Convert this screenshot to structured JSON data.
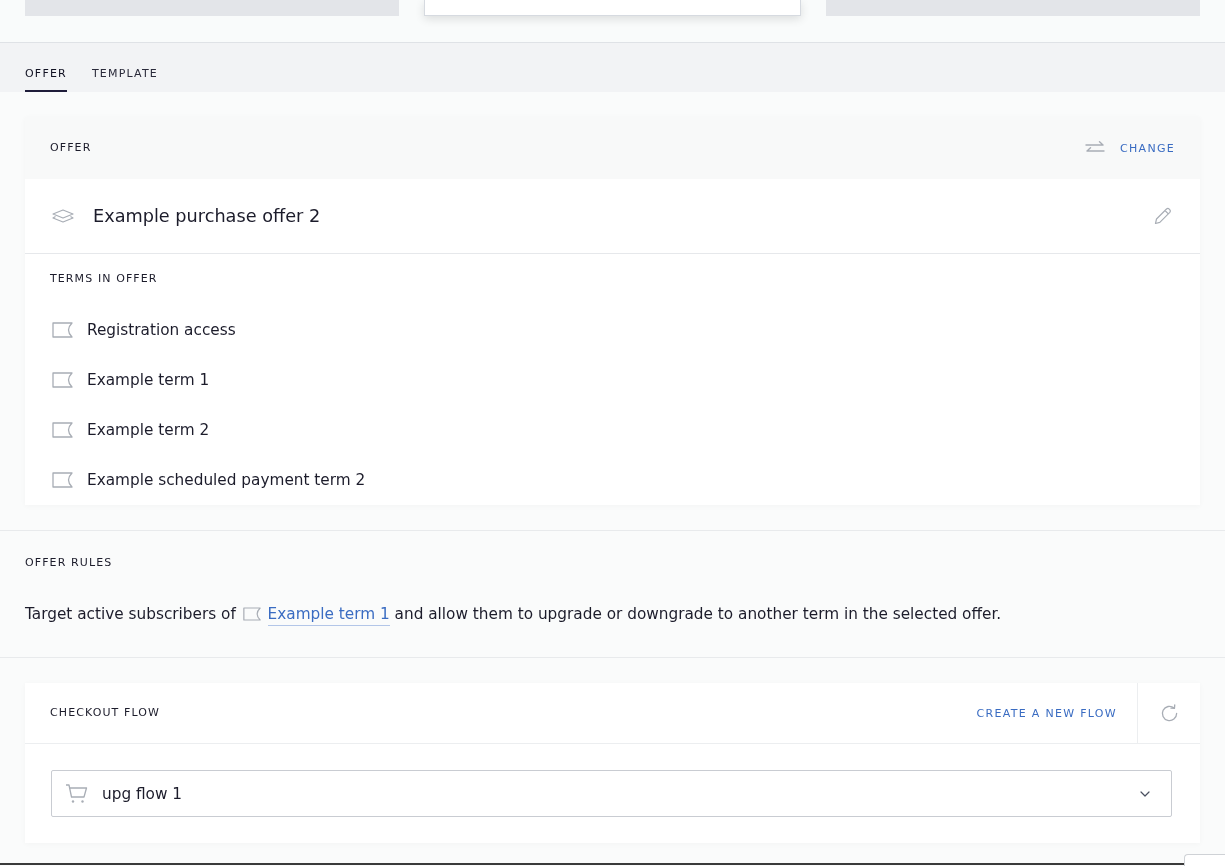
{
  "top_cards": [
    {
      "selected": false
    },
    {
      "selected": true
    },
    {
      "selected": false
    }
  ],
  "tabs": [
    {
      "label": "OFFER",
      "selected": true
    },
    {
      "label": "TEMPLATE",
      "selected": false
    }
  ],
  "offer": {
    "title": "OFFER",
    "change_action": "CHANGE",
    "name": "Example purchase offer 2",
    "terms_title": "TERMS IN OFFER",
    "terms": [
      "Registration access",
      "Example term 1",
      "Example term 2",
      "Example scheduled payment term 2"
    ]
  },
  "offer_rules": {
    "title": "OFFER RULES",
    "text_before": "Target active subscribers of",
    "term_link": "Example term 1",
    "text_after": "and allow them to upgrade or downgrade to another term in the selected offer."
  },
  "checkout_flow": {
    "title": "CHECKOUT FLOW",
    "create_action": "CREATE A NEW FLOW",
    "selected_flow": "upg flow 1"
  }
}
